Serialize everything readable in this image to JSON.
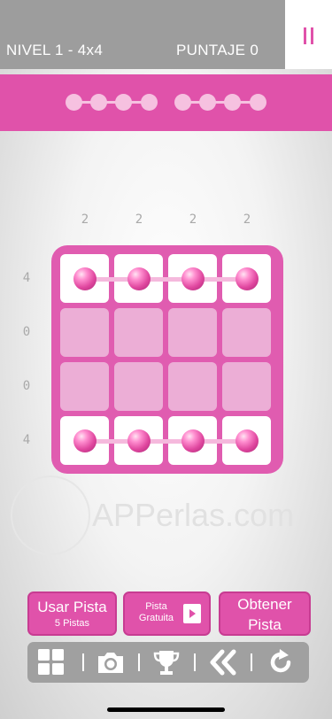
{
  "header": {
    "level": "NIVEL 1 - 4x4",
    "score": "PUNTAJE 0"
  },
  "progress": {
    "group_1_dots": 4,
    "group_2_dots": 4
  },
  "board": {
    "size": 4,
    "column_clues": [
      "2",
      "2",
      "2",
      "2"
    ],
    "row_clues": [
      "4",
      "0",
      "0",
      "4"
    ],
    "rows": [
      [
        1,
        1,
        1,
        1
      ],
      [
        0,
        0,
        0,
        0
      ],
      [
        0,
        0,
        0,
        0
      ],
      [
        1,
        1,
        1,
        1
      ]
    ]
  },
  "watermark": {
    "text": "APPerlas.com"
  },
  "buttons": {
    "use_hint": "Usar Pista",
    "hints_count": "5 Pistas",
    "free_hint_1": "Pista",
    "free_hint_2": "Gratuita",
    "get_hint_1": "Obtener",
    "get_hint_2": "Pista"
  },
  "toolbar": {
    "icons": [
      "grid-icon",
      "camera-icon",
      "trophy-icon",
      "rewind-icon",
      "restart-icon"
    ]
  },
  "colors": {
    "accent": "#e052aa",
    "bar": "#9d9d9d"
  }
}
